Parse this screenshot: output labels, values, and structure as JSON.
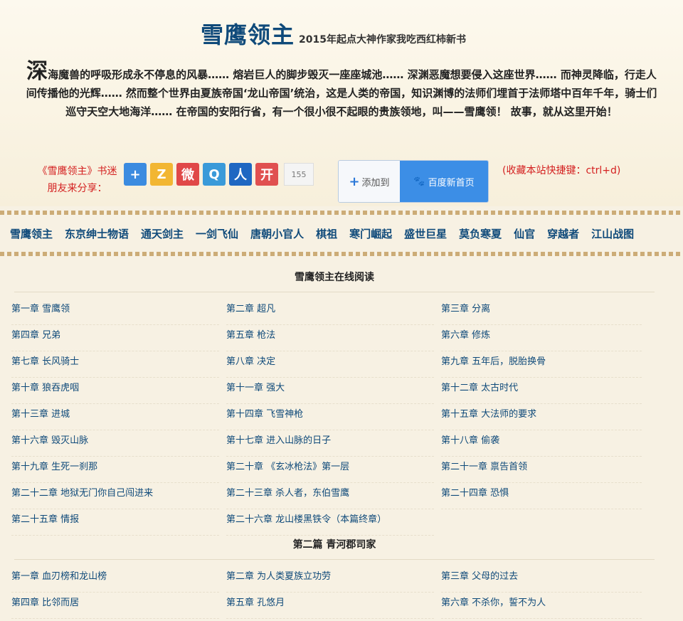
{
  "header": {
    "title": "雪鹰领主",
    "subtitle": "2015年起点大神作家我吃西红柿新书",
    "intro_first_char": "深",
    "intro_rest": "海魔兽的呼吸形成永不停息的风暴…… 熔岩巨人的脚步毁灭一座座城池…… 深渊恶魔想要侵入这座世界…… 而神灵降临，行走人间传播他的光辉…… 然而整个世界由夏族帝国‘龙山帝国’统治，这是人类的帝国，知识渊博的法师们埋首于法师塔中百年千年，骑士们巡守天空大地海洋…… 在帝国的安阳行省，有一个很小很不起眼的贵族领地，叫——雪鹰领！ 故事，就从这里开始！"
  },
  "share": {
    "label_line1": "《雪鹰领主》书迷",
    "label_line2": "朋友来分享：",
    "icons": [
      {
        "name": "add-share-icon",
        "glyph": "+",
        "color": "#3b8be0"
      },
      {
        "name": "qzone-icon",
        "glyph": "Z",
        "color": "#f2b632"
      },
      {
        "name": "weibo-icon",
        "glyph": "微",
        "color": "#e04848"
      },
      {
        "name": "tencent-weibo-icon",
        "glyph": "Q",
        "color": "#3a9ad9"
      },
      {
        "name": "renren-icon",
        "glyph": "人",
        "color": "#1f67c2"
      },
      {
        "name": "kaixin-icon",
        "glyph": "开",
        "color": "#e05050"
      }
    ],
    "count": "155"
  },
  "baidu": {
    "add_label": "添加到",
    "home_label": "百度新首页"
  },
  "favorite_hint": "(收藏本站快捷键：ctrl+d)",
  "nav": [
    "雪鹰领主",
    "东京绅士物语",
    "通天剑主",
    "一剑飞仙",
    "唐朝小官人",
    "棋祖",
    "寒门崛起",
    "盛世巨星",
    "莫负寒夏",
    "仙官",
    "穿越者",
    "江山战图"
  ],
  "sections": [
    {
      "title": "雪鹰领主在线阅读",
      "chapters": [
        "第一章 雪鹰领",
        "第二章 超凡",
        "第三章 分离",
        "第四章 兄弟",
        "第五章 枪法",
        "第六章 修炼",
        "第七章 长风骑士",
        "第八章 决定",
        "第九章 五年后，脱胎换骨",
        "第十章 狼吞虎咽",
        "第十一章 强大",
        "第十二章 太古时代",
        "第十三章 进城",
        "第十四章 飞雪神枪",
        "第十五章 大法师的要求",
        "第十六章 毁灭山脉",
        "第十七章 进入山脉的日子",
        "第十八章 偷袭",
        "第十九章 生死一刹那",
        "第二十章 《玄冰枪法》第一层",
        "第二十一章 禀告首领",
        "第二十二章 地狱无门你自己闯进来",
        "第二十三章 杀人者，东伯雪鹰",
        "第二十四章 恐惧",
        "第二十五章 情报",
        "第二十六章 龙山楼黑铁令（本篇终章）"
      ]
    },
    {
      "title": "第二篇 青河郡司家",
      "chapters": [
        "第一章 血刃榜和龙山榜",
        "第二章 为人类夏族立功劳",
        "第三章 父母的过去",
        "第四章 比邻而居",
        "第五章 孔悠月",
        "第六章 不杀你，誓不为人"
      ]
    }
  ]
}
